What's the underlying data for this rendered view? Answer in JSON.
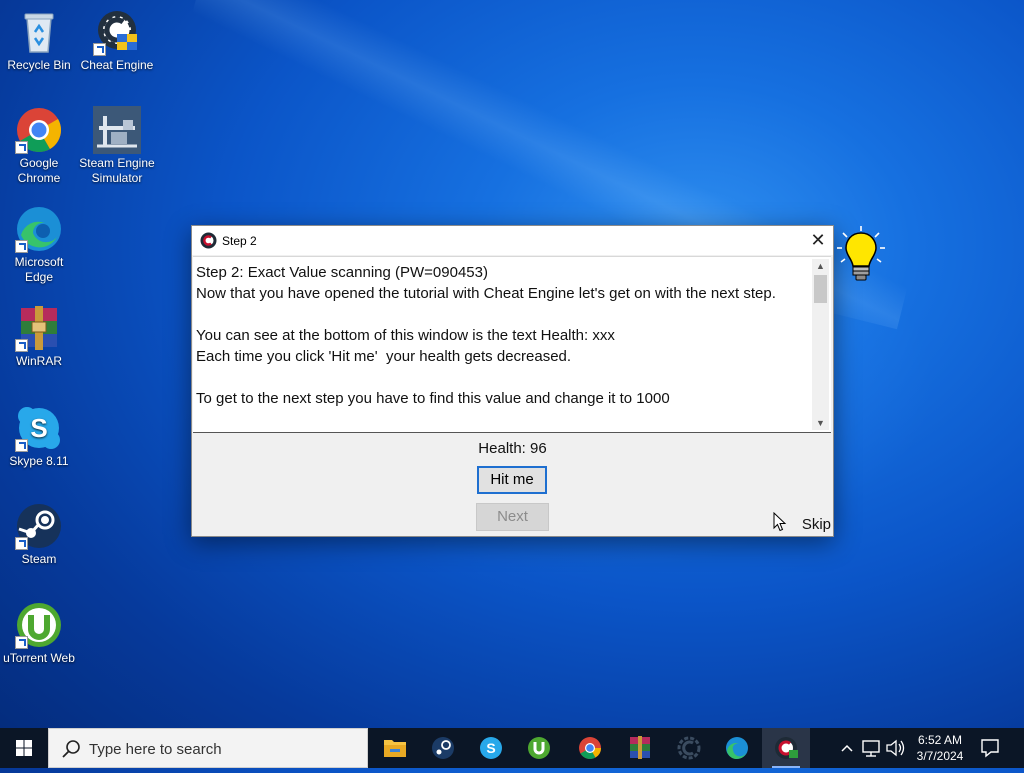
{
  "desktop": {
    "icons": [
      {
        "label": "Recycle Bin"
      },
      {
        "label": "Cheat Engine"
      },
      {
        "label": "Google Chrome"
      },
      {
        "label": "Steam Engine Simulator"
      },
      {
        "label": "Microsoft Edge"
      },
      {
        "label": "WinRAR"
      },
      {
        "label": "Skype 8.11"
      },
      {
        "label": "Steam"
      },
      {
        "label": "uTorrent Web"
      }
    ]
  },
  "window": {
    "title": "Step 2",
    "close_glyph": "✕",
    "text_lines": "Step 2: Exact Value scanning (PW=090453)\nNow that you have opened the tutorial with Cheat Engine let's get on with the next step.\n\nYou can see at the bottom of this window is the text Health: xxx\nEach time you click 'Hit me'  your health gets decreased.\n\nTo get to the next step you have to find this value and change it to 1000",
    "health_label": "Health: 96",
    "hit_button": "Hit me",
    "next_button": "Next",
    "skip_label": "Skip"
  },
  "taskbar": {
    "search_placeholder": "Type here to search",
    "apps": [
      "File Explorer",
      "Steam",
      "Skype",
      "uTorrent",
      "Google Chrome",
      "WinRAR",
      "Cheat Engine",
      "Microsoft Edge",
      "Cheat Engine Tutorial"
    ],
    "clock_time": "6:52 AM",
    "clock_date": "3/7/2024"
  },
  "colors": {
    "accent": "#1e6fd0",
    "taskbar": "#0b1626"
  }
}
